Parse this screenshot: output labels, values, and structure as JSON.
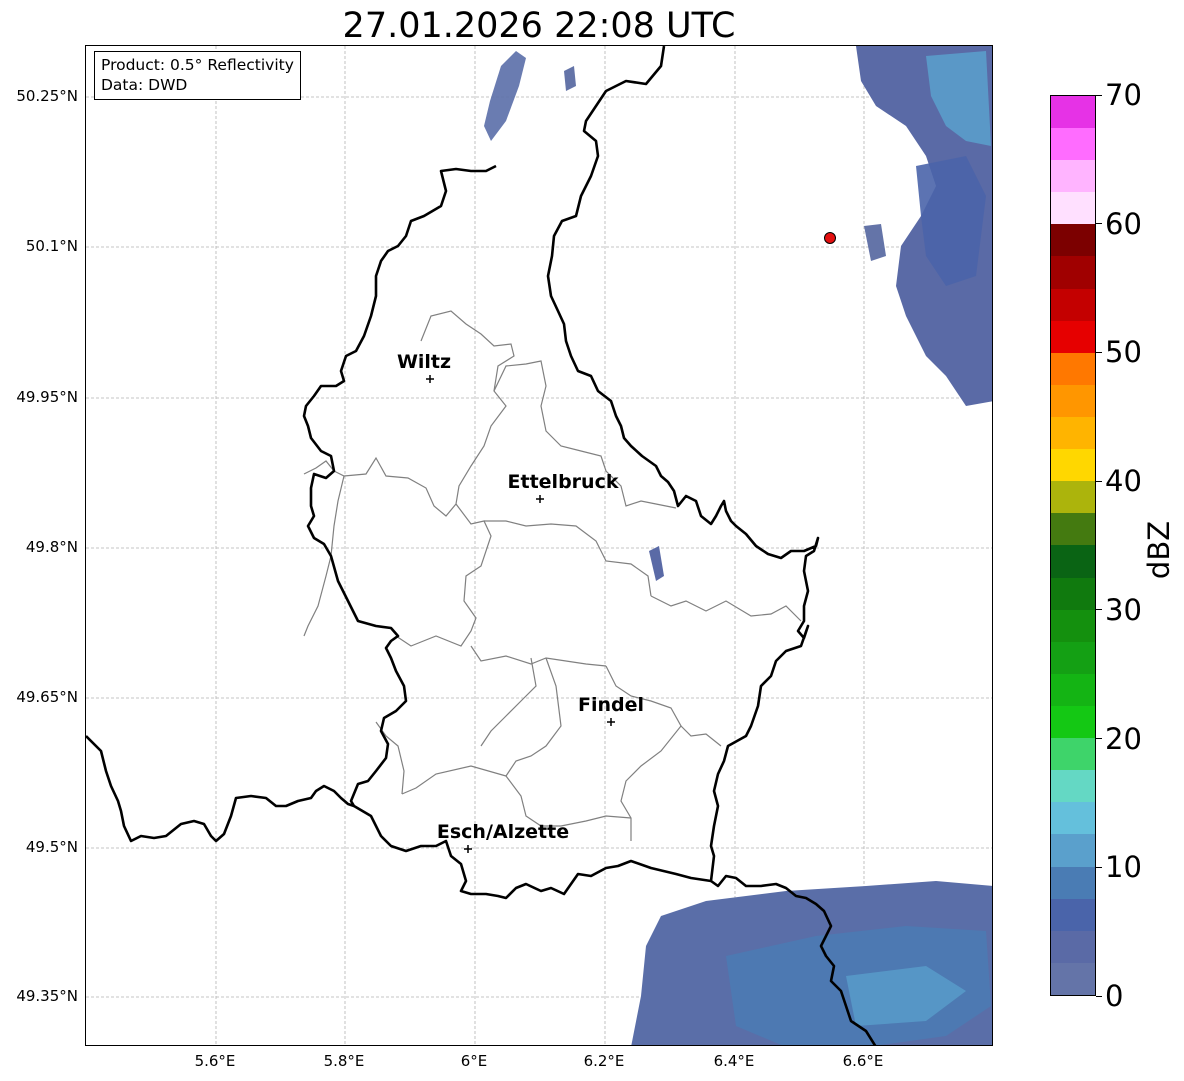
{
  "title": "27.01.2026 22:08 UTC",
  "info": {
    "product": "Product: 0.5° Reflectivity",
    "data": "Data: DWD"
  },
  "latitude_labels": [
    "50.25°N",
    "50.1°N",
    "49.95°N",
    "49.8°N",
    "49.65°N",
    "49.5°N",
    "49.35°N"
  ],
  "longitude_labels": [
    "5.6°E",
    "5.8°E",
    "6°E",
    "6.2°E",
    "6.4°E",
    "6.6°E"
  ],
  "cities": [
    {
      "name": "Wiltz"
    },
    {
      "name": "Ettelbruck"
    },
    {
      "name": "Findel"
    },
    {
      "name": "Esch/Alzette"
    }
  ],
  "radar_site_marker": {
    "color": "#e31010"
  },
  "colorbar": {
    "unit": "dBZ",
    "tick_labels": [
      "0",
      "10",
      "20",
      "30",
      "40",
      "50",
      "60",
      "70"
    ],
    "range": [
      0,
      70
    ],
    "step": 2.5,
    "colors": [
      "#6474a8",
      "#5a6aa6",
      "#4a64aa",
      "#4a7cb4",
      "#5aa0cc",
      "#64c0dc",
      "#64d8c4",
      "#3ed46a",
      "#14c814",
      "#14b414",
      "#14a014",
      "#14900e",
      "#107a0e",
      "#0a6414",
      "#447a10",
      "#acb40c",
      "#ffd700",
      "#ffb400",
      "#ff9600",
      "#ff7800",
      "#e60000",
      "#c40000",
      "#a00000",
      "#7c0000",
      "#ffe0ff",
      "#ffb4ff",
      "#ff6cff",
      "#e632e6"
    ]
  },
  "colors": {
    "border": "#000000",
    "admin": "#808080",
    "grid": "#b4b4b4",
    "radar_low": "#5a6ea8"
  }
}
